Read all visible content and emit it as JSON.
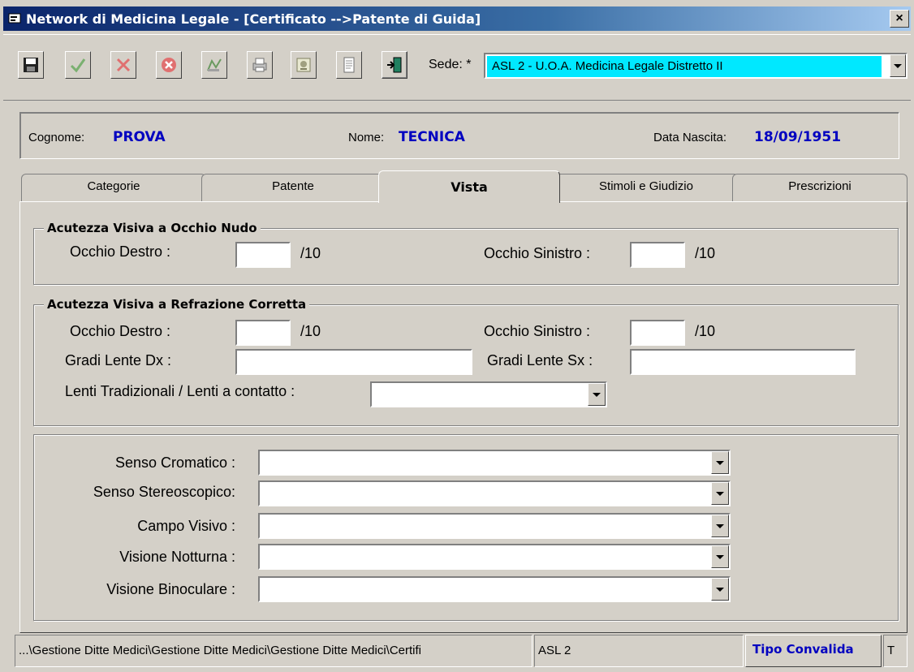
{
  "window": {
    "title": "Network di Medicina Legale - [Certificato -->Patente di Guida]",
    "close_label": "×"
  },
  "toolbar": {
    "buttons": [
      "save-icon",
      "confirm-icon",
      "cancel-icon",
      "delete-icon",
      "edit-icon",
      "print-icon",
      "certificate-icon",
      "document-icon",
      "exit-icon"
    ],
    "sede_label": "Sede: *",
    "sede_value": "ASL 2 - U.O.A. Medicina Legale Distretto II"
  },
  "patient": {
    "cognome_label": "Cognome:",
    "cognome": "PROVA",
    "nome_label": "Nome:",
    "nome": "TECNICA",
    "nascita_label": "Data Nascita:",
    "nascita": "18/09/1951"
  },
  "tabs": [
    "Categorie",
    "Patente",
    "Vista",
    "Stimoli e Giudizio",
    "Prescrizioni"
  ],
  "active_tab": "Vista",
  "nudo": {
    "legend": "Acutezza Visiva a Occhio Nudo",
    "dx_label": "Occhio Destro :",
    "sx_label": "Occhio Sinistro :",
    "unit": "/10"
  },
  "corretta": {
    "legend": "Acutezza Visiva a Refrazione Corretta",
    "dx_label": "Occhio Destro :",
    "sx_label": "Occhio Sinistro :",
    "unit": "/10",
    "lente_dx_label": "Gradi Lente Dx :",
    "lente_sx_label": "Gradi Lente Sx :",
    "lenti_label": "Lenti Tradizionali / Lenti a contatto :"
  },
  "sensi": {
    "cromatico": "Senso Cromatico :",
    "stereo": "Senso Stereoscopico:",
    "campo": "Campo Visivo :",
    "notturna": "Visione Notturna :",
    "binoculare": "Visione Binoculare :"
  },
  "status": {
    "path": "...\\Gestione Ditte Medici\\Gestione Ditte Medici\\Gestione Ditte Medici\\Certifi",
    "asl": "ASL 2",
    "tipo": "Tipo Convalida",
    "last": "T"
  },
  "colors": {
    "sede_highlight": "#00e8ff",
    "value_blue": "#0000c0"
  }
}
